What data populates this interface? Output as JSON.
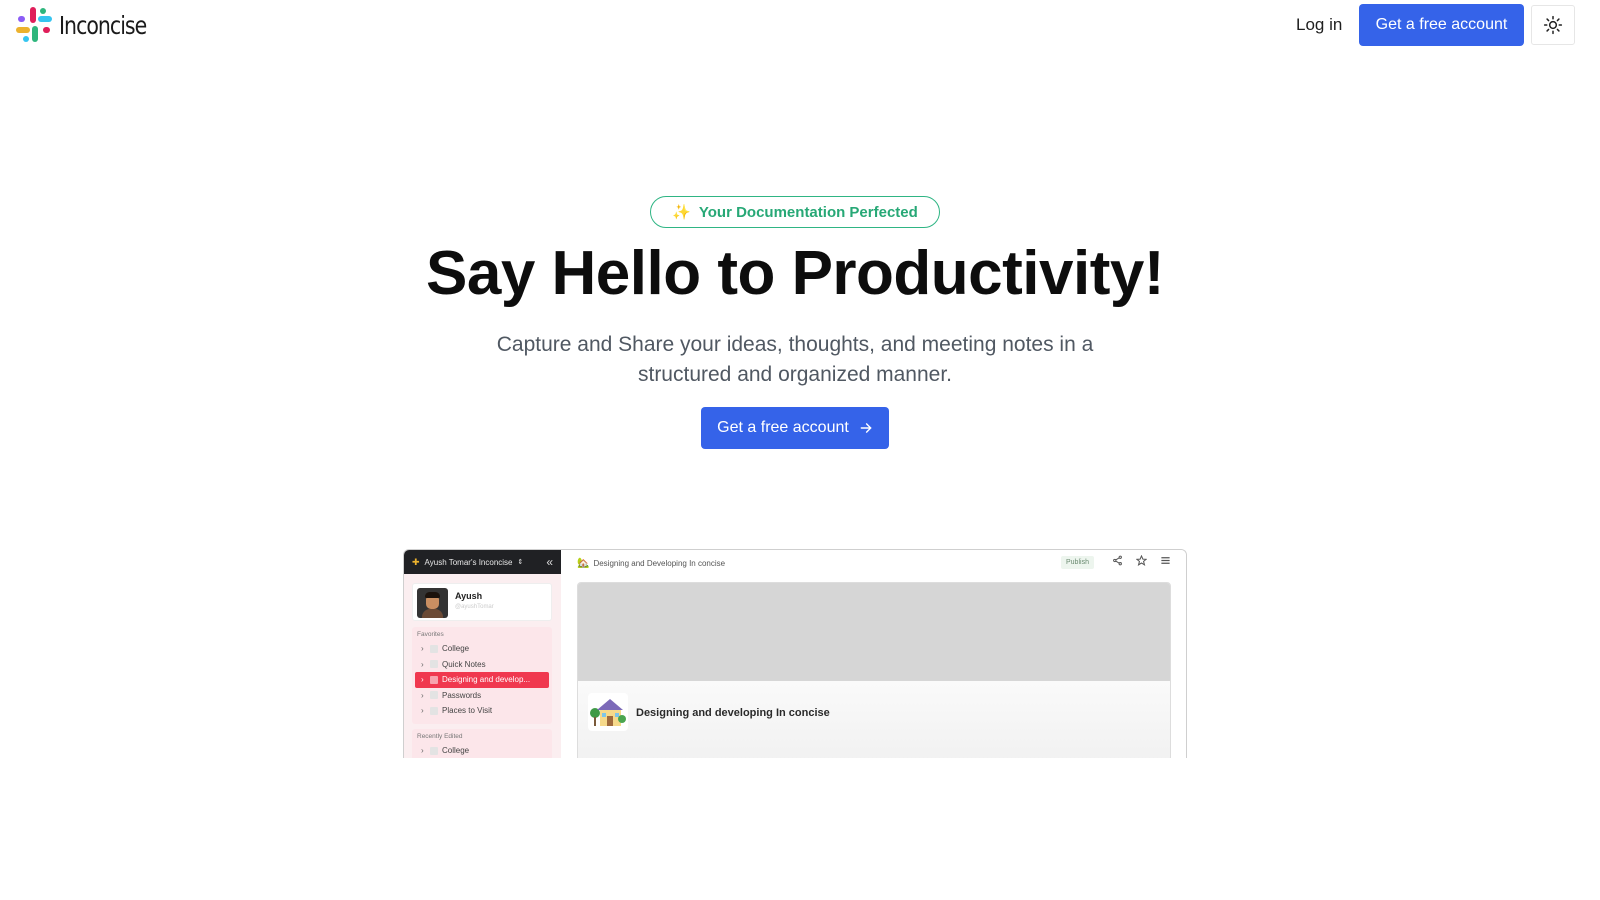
{
  "header": {
    "brand": "Inconcise",
    "login_label": "Log in",
    "cta_label": "Get a free account",
    "theme_icon": "sun-icon"
  },
  "hero": {
    "badge_icon": "sparkles-icon",
    "badge_text": "Your Documentation Perfected",
    "title": "Say Hello to Productivity!",
    "subtitle_line1": "Capture and Share your ideas, thoughts, and meeting notes in a",
    "subtitle_line2": "structured and organized manner.",
    "cta_label": "Get a free account",
    "cta_icon": "arrow-right-icon"
  },
  "preview": {
    "workspace_name": "Ayush Tomar's Inconcise",
    "user_name": "Ayush",
    "user_handle": "@ayushTomar",
    "favorites_label": "Favorites",
    "favorites": [
      {
        "label": "College",
        "active": false
      },
      {
        "label": "Quick Notes",
        "active": false
      },
      {
        "label": "Designing and develop...",
        "active": true
      },
      {
        "label": "Passwords",
        "active": false
      },
      {
        "label": "Places to Visit",
        "active": false
      }
    ],
    "recent_label": "Recently Edited",
    "recent": [
      {
        "label": "College"
      }
    ],
    "breadcrumb": "Designing and Developing In concise",
    "publish_label": "Publish",
    "doc_title": "Designing and developing In concise"
  },
  "colors": {
    "primary": "#3563e9",
    "badge_green": "#27a876",
    "active_item": "#f0384f",
    "logo_blue": "#36c5f0",
    "logo_green": "#2eb67d",
    "logo_red": "#e01e5a",
    "logo_yellow": "#ecb22e",
    "logo_purple": "#8b5cf6"
  }
}
